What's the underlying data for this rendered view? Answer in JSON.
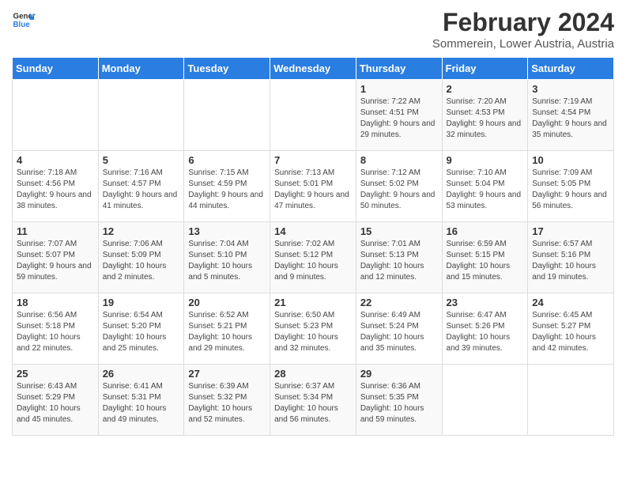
{
  "header": {
    "logo_line1": "General",
    "logo_line2": "Blue",
    "title": "February 2024",
    "subtitle": "Sommerein, Lower Austria, Austria"
  },
  "days_of_week": [
    "Sunday",
    "Monday",
    "Tuesday",
    "Wednesday",
    "Thursday",
    "Friday",
    "Saturday"
  ],
  "weeks": [
    [
      {
        "day": "",
        "content": ""
      },
      {
        "day": "",
        "content": ""
      },
      {
        "day": "",
        "content": ""
      },
      {
        "day": "",
        "content": ""
      },
      {
        "day": "1",
        "content": "Sunrise: 7:22 AM\nSunset: 4:51 PM\nDaylight: 9 hours and 29 minutes."
      },
      {
        "day": "2",
        "content": "Sunrise: 7:20 AM\nSunset: 4:53 PM\nDaylight: 9 hours and 32 minutes."
      },
      {
        "day": "3",
        "content": "Sunrise: 7:19 AM\nSunset: 4:54 PM\nDaylight: 9 hours and 35 minutes."
      }
    ],
    [
      {
        "day": "4",
        "content": "Sunrise: 7:18 AM\nSunset: 4:56 PM\nDaylight: 9 hours and 38 minutes."
      },
      {
        "day": "5",
        "content": "Sunrise: 7:16 AM\nSunset: 4:57 PM\nDaylight: 9 hours and 41 minutes."
      },
      {
        "day": "6",
        "content": "Sunrise: 7:15 AM\nSunset: 4:59 PM\nDaylight: 9 hours and 44 minutes."
      },
      {
        "day": "7",
        "content": "Sunrise: 7:13 AM\nSunset: 5:01 PM\nDaylight: 9 hours and 47 minutes."
      },
      {
        "day": "8",
        "content": "Sunrise: 7:12 AM\nSunset: 5:02 PM\nDaylight: 9 hours and 50 minutes."
      },
      {
        "day": "9",
        "content": "Sunrise: 7:10 AM\nSunset: 5:04 PM\nDaylight: 9 hours and 53 minutes."
      },
      {
        "day": "10",
        "content": "Sunrise: 7:09 AM\nSunset: 5:05 PM\nDaylight: 9 hours and 56 minutes."
      }
    ],
    [
      {
        "day": "11",
        "content": "Sunrise: 7:07 AM\nSunset: 5:07 PM\nDaylight: 9 hours and 59 minutes."
      },
      {
        "day": "12",
        "content": "Sunrise: 7:06 AM\nSunset: 5:09 PM\nDaylight: 10 hours and 2 minutes."
      },
      {
        "day": "13",
        "content": "Sunrise: 7:04 AM\nSunset: 5:10 PM\nDaylight: 10 hours and 5 minutes."
      },
      {
        "day": "14",
        "content": "Sunrise: 7:02 AM\nSunset: 5:12 PM\nDaylight: 10 hours and 9 minutes."
      },
      {
        "day": "15",
        "content": "Sunrise: 7:01 AM\nSunset: 5:13 PM\nDaylight: 10 hours and 12 minutes."
      },
      {
        "day": "16",
        "content": "Sunrise: 6:59 AM\nSunset: 5:15 PM\nDaylight: 10 hours and 15 minutes."
      },
      {
        "day": "17",
        "content": "Sunrise: 6:57 AM\nSunset: 5:16 PM\nDaylight: 10 hours and 19 minutes."
      }
    ],
    [
      {
        "day": "18",
        "content": "Sunrise: 6:56 AM\nSunset: 5:18 PM\nDaylight: 10 hours and 22 minutes."
      },
      {
        "day": "19",
        "content": "Sunrise: 6:54 AM\nSunset: 5:20 PM\nDaylight: 10 hours and 25 minutes."
      },
      {
        "day": "20",
        "content": "Sunrise: 6:52 AM\nSunset: 5:21 PM\nDaylight: 10 hours and 29 minutes."
      },
      {
        "day": "21",
        "content": "Sunrise: 6:50 AM\nSunset: 5:23 PM\nDaylight: 10 hours and 32 minutes."
      },
      {
        "day": "22",
        "content": "Sunrise: 6:49 AM\nSunset: 5:24 PM\nDaylight: 10 hours and 35 minutes."
      },
      {
        "day": "23",
        "content": "Sunrise: 6:47 AM\nSunset: 5:26 PM\nDaylight: 10 hours and 39 minutes."
      },
      {
        "day": "24",
        "content": "Sunrise: 6:45 AM\nSunset: 5:27 PM\nDaylight: 10 hours and 42 minutes."
      }
    ],
    [
      {
        "day": "25",
        "content": "Sunrise: 6:43 AM\nSunset: 5:29 PM\nDaylight: 10 hours and 45 minutes."
      },
      {
        "day": "26",
        "content": "Sunrise: 6:41 AM\nSunset: 5:31 PM\nDaylight: 10 hours and 49 minutes."
      },
      {
        "day": "27",
        "content": "Sunrise: 6:39 AM\nSunset: 5:32 PM\nDaylight: 10 hours and 52 minutes."
      },
      {
        "day": "28",
        "content": "Sunrise: 6:37 AM\nSunset: 5:34 PM\nDaylight: 10 hours and 56 minutes."
      },
      {
        "day": "29",
        "content": "Sunrise: 6:36 AM\nSunset: 5:35 PM\nDaylight: 10 hours and 59 minutes."
      },
      {
        "day": "",
        "content": ""
      },
      {
        "day": "",
        "content": ""
      }
    ]
  ]
}
